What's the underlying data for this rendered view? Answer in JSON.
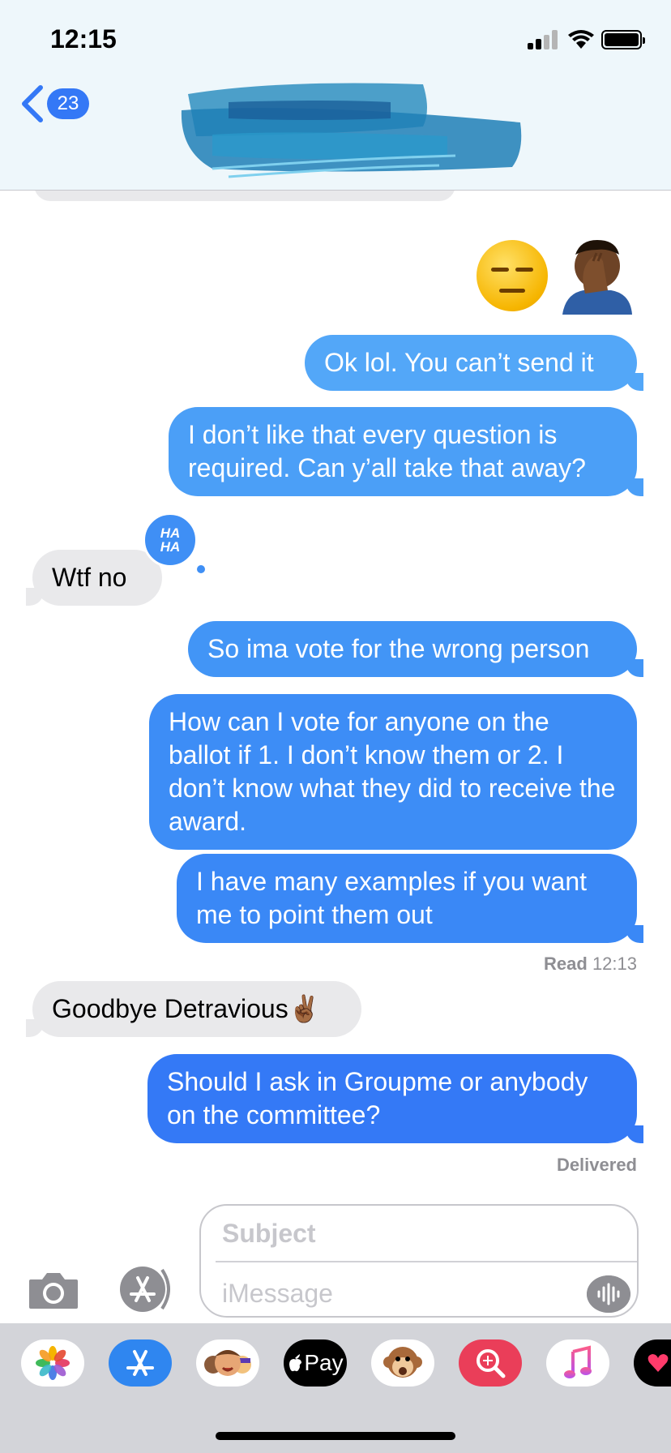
{
  "status_bar": {
    "time": "12:15"
  },
  "nav": {
    "back_badge": "23"
  },
  "messages": {
    "m1": "Ok lol. You can’t send it",
    "m2": "I don’t like that every question is required. Can y’all take that away?",
    "m3": "Wtf no",
    "m4": "So ima vote for the wrong person",
    "m5": "How can I vote for anyone on the ballot if 1. I don’t know them or 2. I don’t know what they did to receive the award.",
    "m6": "I have many examples if you want me to point them out",
    "m7": "Goodbye Detravious✌🏾",
    "m8": "Should I ask in Groupme or anybody on the committee?"
  },
  "tapback_label": "HA HA",
  "read_receipt": {
    "label": "Read",
    "time": "12:13"
  },
  "delivered_receipt": "Delivered",
  "compose": {
    "subject_placeholder": "Subject",
    "message_placeholder": "iMessage"
  },
  "app_drawer": {
    "apps": [
      "photos-icon",
      "app-store-icon",
      "memoji-icon",
      "apple-pay-icon",
      "animoji-icon",
      "image-search-icon",
      "music-icon",
      "digital-touch-icon"
    ],
    "apple_pay_label": "Pay"
  },
  "colors": {
    "sent_blue": "#3478f6",
    "received_gray": "#e9e9eb",
    "header_bg": "#eef7fb"
  }
}
